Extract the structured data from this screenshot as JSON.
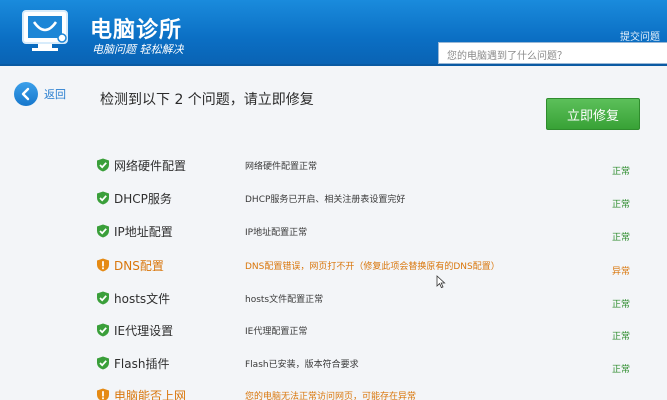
{
  "app": {
    "title": "电脑诊所",
    "subtitle": "电脑问题 轻松解决",
    "help": "提交问题",
    "search_placeholder": "您的电脑遇到了什么问题？"
  },
  "toolbar": {
    "back_label": "返回",
    "summary": "检测到以下 2 个问题，请立即修复",
    "fix_label": "立即修复"
  },
  "colors": {
    "header": "#0b6fc4",
    "ok": "#3a9f3a",
    "warn": "#d9760b",
    "fix_button": "#44ad42"
  },
  "items": [
    {
      "name": "网络硬件配置",
      "desc": "网络硬件配置正常",
      "status": "正常",
      "state": "ok"
    },
    {
      "name": "DHCP服务",
      "desc": "DHCP服务已开启、相关注册表设置完好",
      "status": "正常",
      "state": "ok"
    },
    {
      "name": "IP地址配置",
      "desc": "IP地址配置正常",
      "status": "正常",
      "state": "ok"
    },
    {
      "name": "DNS配置",
      "desc": "DNS配置错误，网页打不开（修复此项会替换原有的DNS配置）",
      "status": "异常",
      "state": "warn"
    },
    {
      "name": "hosts文件",
      "desc": "hosts文件配置正常",
      "status": "正常",
      "state": "ok"
    },
    {
      "name": "IE代理设置",
      "desc": "IE代理配置正常",
      "status": "正常",
      "state": "ok"
    },
    {
      "name": "Flash插件",
      "desc": "Flash已安装，版本符合要求",
      "status": "正常",
      "state": "ok"
    },
    {
      "name": "电脑能否上网",
      "desc": "您的电脑无法正常访问网页，可能存在异常",
      "status": "",
      "state": "warn"
    }
  ]
}
